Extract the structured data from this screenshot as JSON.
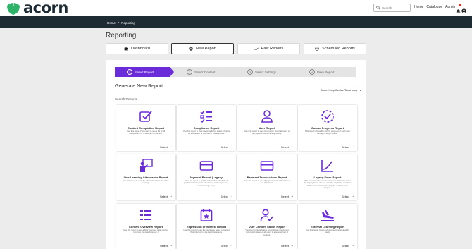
{
  "brand": {
    "name": "acorn",
    "color": "#2fb369"
  },
  "search": {
    "placeholder": "Search"
  },
  "topnav": [
    "Home",
    "Catalogue",
    "Admin"
  ],
  "breadcrumb": {
    "home": "Home",
    "separator": "▸",
    "current": "Reporting"
  },
  "page": {
    "title": "Reporting"
  },
  "tabs": [
    {
      "label": "Dashboard",
      "icon": "puzzle-icon"
    },
    {
      "label": "New Report",
      "icon": "plus-circle-icon",
      "active": true
    },
    {
      "label": "Past Reports",
      "icon": "trend-icon"
    },
    {
      "label": "Scheduled Reports",
      "icon": "clock-icon"
    }
  ],
  "steps": [
    {
      "num": "1",
      "label": "Select Report",
      "active": true
    },
    {
      "num": "2",
      "label": "Select Content"
    },
    {
      "num": "3",
      "label": "Select Settings"
    },
    {
      "num": "4",
      "label": "View Report"
    }
  ],
  "generate": {
    "title": "Generate New Report",
    "taxonomy": "Acorn Help Centre Taxonomy",
    "search_label": "Search Reports"
  },
  "accent": "#6a2bd8",
  "reports": [
    {
      "title": "Content Completion Report",
      "desc": "Use this report if you want to see a list of all completions for a selection of content.",
      "select": "Select",
      "icon": "checkbox-icon"
    },
    {
      "title": "Compliance Report",
      "desc": "Use this report to view the compliance status of users on a selection of courses or live learnings.",
      "select": "Select",
      "icon": "checklist-icon"
    },
    {
      "title": "User Report",
      "desc": "Use this report to view information about all users or any specific users training history.",
      "select": "Select",
      "icon": "user-icon"
    },
    {
      "title": "Course Progress Report",
      "desc": "This report shows the activity progress of each user through a single course.",
      "select": "Select",
      "icon": "progress-circle-icon"
    },
    {
      "title": "Live Learning Attendance Report",
      "desc": "Use this report to view the attendance for a list of live learnings.",
      "select": "Select",
      "icon": "presenter-icon"
    },
    {
      "title": "Payment Report (Legacy)",
      "desc": "Use this report to get the information about all of purchase transactions of selected content (courses, live learnings, etc.)",
      "select": "Select",
      "icon": "credit-card-icon"
    },
    {
      "title": "Payment Transactions Report",
      "desc": "Use this report to see all payment transactions for a set of content.",
      "select": "Select",
      "icon": "credit-card-icon"
    },
    {
      "title": "Legacy Form Report",
      "desc": "This report can be used to view form submissions for the legacy forms. Please consider migrating over form to the new version and using the updated Form Report.",
      "select": "Select",
      "icon": "chart-line-icon"
    },
    {
      "title": "Content Overview Report",
      "desc": "Use this report to see a brief overview of all content (courses, live learnings, etc.)",
      "select": "Select",
      "icon": "list-icon"
    },
    {
      "title": "Expression of Interest Report",
      "desc": "Use this report to see the users who have expressed their interest in Live Learning events.",
      "select": "Select",
      "icon": "calendar-star-icon"
    },
    {
      "title": "User Content Status Report",
      "desc": "The User Content Status report shows the current completion status of all users in a selected set of content.",
      "select": "Select",
      "icon": "user-check-icon"
    },
    {
      "title": "External Learning Report",
      "desc": "Use this report to see external learning created by users.",
      "select": "Select",
      "icon": "plane-icon"
    }
  ]
}
